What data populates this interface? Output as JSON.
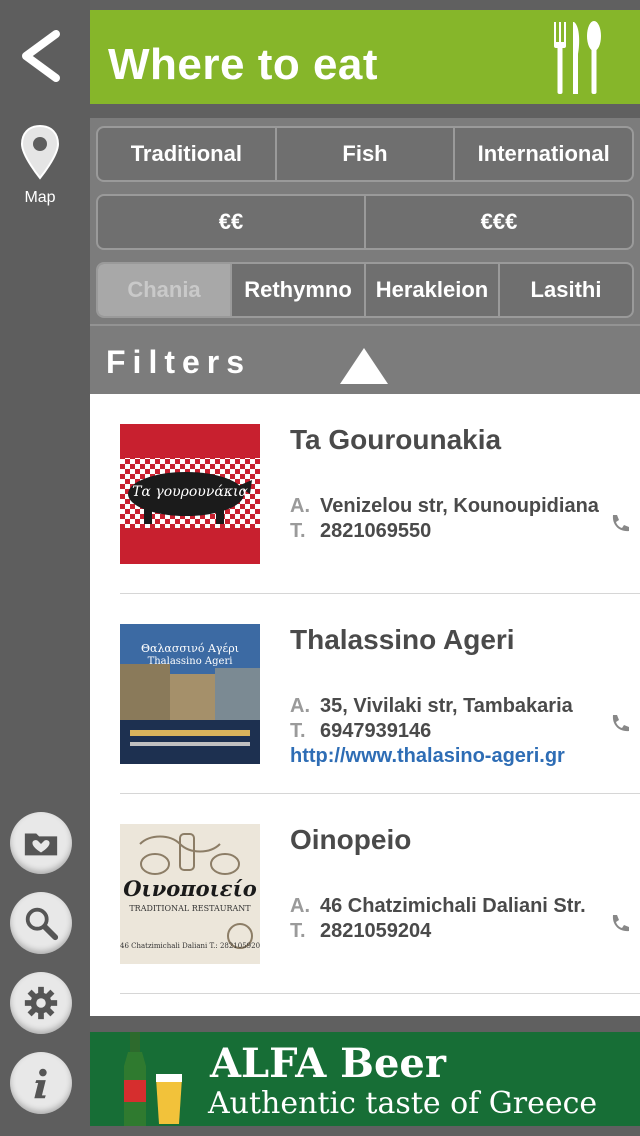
{
  "header": {
    "title": "Where to eat"
  },
  "sidebar": {
    "map_label": "Map"
  },
  "filters": {
    "cuisine": [
      "Traditional",
      "Fish",
      "International"
    ],
    "price": [
      "€€",
      "€€€"
    ],
    "regions": [
      "Chania",
      "Rethymno",
      "Herakleion",
      "Lasithi"
    ],
    "selected_region": "Chania",
    "label": "Filters"
  },
  "restaurants": [
    {
      "name": "Ta Gourounakia",
      "address": "Venizelou str, Kounoupidiana",
      "phone": "2821069550",
      "url": "",
      "logo_text": "Τα γουρουνάκια"
    },
    {
      "name": "Thalassino Ageri",
      "address": "35, Vivilaki str, Tambakaria",
      "phone": "6947939146",
      "url": "http://www.thalasino-ageri.gr",
      "logo_text": "Θαλασσινό Αγέρι",
      "logo_sub": "Thalassino Ageri"
    },
    {
      "name": "Oinopeio",
      "address": "46 Chatzimichali Daliani Str.",
      "phone": "2821059204",
      "url": "",
      "logo_text": "Οινοποιείο",
      "logo_sub": "TRADITIONAL RESTAURANT",
      "logo_foot": "46 Chatzimichali Daliani T.: 2821059204"
    }
  ],
  "labels": {
    "address_key": "A.",
    "phone_key": "T."
  },
  "ad": {
    "title": "ALFA Beer",
    "subtitle": "Authentic taste of Greece"
  },
  "colors": {
    "accent": "#86b62a",
    "ad_bg": "#176e36",
    "link": "#2e6db5"
  }
}
